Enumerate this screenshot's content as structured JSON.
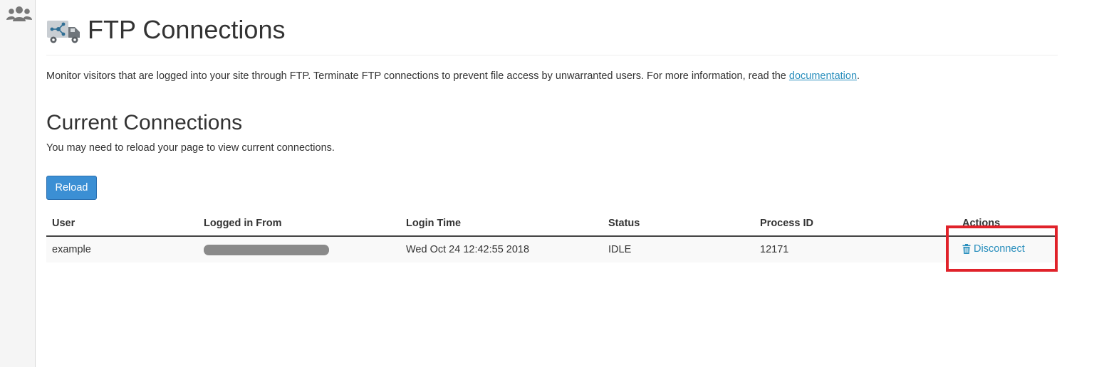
{
  "page": {
    "title": "FTP Connections",
    "description_prefix": "Monitor visitors that are logged into your site through FTP. Terminate FTP connections to prevent file access by unwarranted users. For more information, read the ",
    "description_link": "documentation",
    "description_suffix": "."
  },
  "connections": {
    "title": "Current Connections",
    "note": "You may need to reload your page to view current connections.",
    "reload_label": "Reload",
    "columns": [
      "User",
      "Logged in From",
      "Login Time",
      "Status",
      "Process ID",
      "Actions"
    ],
    "rows": [
      {
        "user": "example",
        "logged_in_from": "",
        "login_time": "Wed Oct 24 12:42:55 2018",
        "status": "IDLE",
        "process_id": "12171",
        "action_label": "Disconnect"
      }
    ]
  },
  "icons": {
    "sidebar": "users-icon",
    "page": "ftp-truck-icon",
    "action": "trash-icon"
  },
  "colors": {
    "accent": "#2a8fbd",
    "button": "#3b8fd4",
    "highlight": "#e0222a"
  }
}
